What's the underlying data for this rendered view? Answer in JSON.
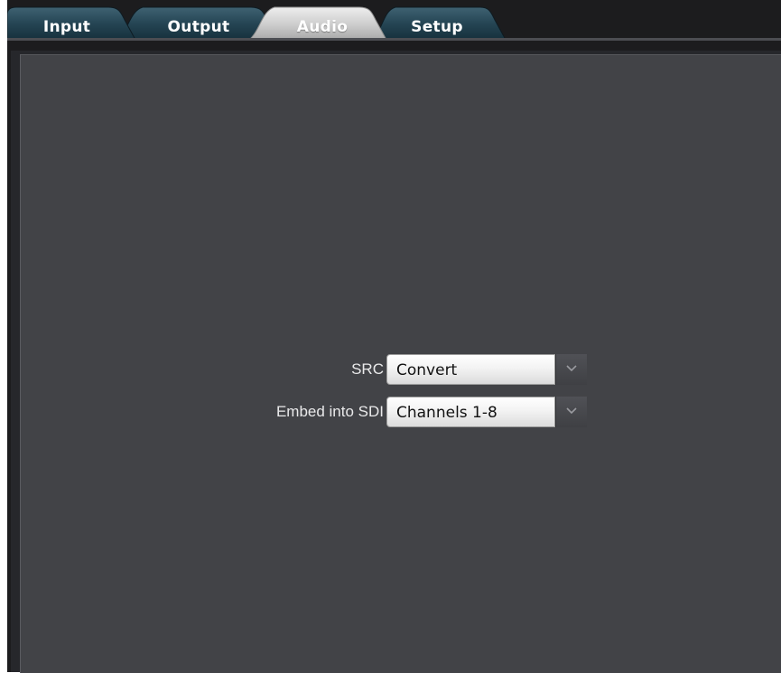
{
  "tabs": [
    {
      "label": "Input",
      "active": false
    },
    {
      "label": "Output",
      "active": false
    },
    {
      "label": "Audio",
      "active": true
    },
    {
      "label": "Setup",
      "active": false
    }
  ],
  "audio_settings": {
    "src": {
      "label": "SRC",
      "value": "Convert"
    },
    "embed": {
      "label": "Embed into SDI",
      "value": "Channels 1-8"
    }
  },
  "icons": {
    "dropdown": "chevron-down-icon"
  },
  "colors": {
    "window_bg": "#1c1c1e",
    "panel_bg": "#424347",
    "tab_inactive": "#1f3b48",
    "tab_active": "#c9c9c9"
  }
}
